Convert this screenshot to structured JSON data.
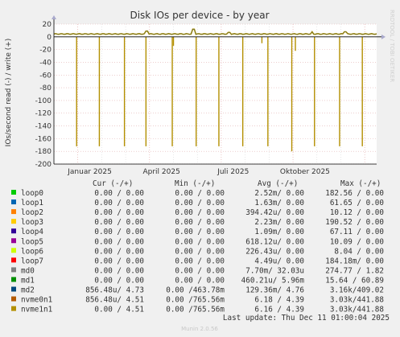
{
  "chart_data": {
    "type": "line",
    "title": "Disk IOs per device - by year",
    "ylabel": "IOs/second read (-) / write (+)",
    "side_label": "RRDTOOL / TOBI OETIKER",
    "ylim": [
      -200,
      20
    ],
    "yticks": [
      20,
      0,
      -20,
      -40,
      -60,
      -80,
      -100,
      -120,
      -140,
      -160,
      -180,
      -200
    ],
    "x_range_months": [
      0,
      13.5
    ],
    "x_month_labels": [
      {
        "label": "Januar 2025",
        "month": 1.5
      },
      {
        "label": "April 2025",
        "month": 4.5
      },
      {
        "label": "Juli 2025",
        "month": 7.5
      },
      {
        "label": "Oktober 2025",
        "month": 10.5
      }
    ],
    "x_minor_months": [
      1,
      2,
      3,
      4,
      5,
      6,
      7,
      8,
      9,
      10,
      11,
      12,
      13
    ],
    "x_major_months": [
      1,
      4,
      7,
      10,
      13
    ],
    "baseline_write": 4.5,
    "read_spikes": [
      {
        "t": 0.95,
        "v": -172
      },
      {
        "t": 1.9,
        "v": -172
      },
      {
        "t": 2.95,
        "v": -172
      },
      {
        "t": 3.85,
        "v": -172
      },
      {
        "t": 4.95,
        "v": -172
      },
      {
        "t": 5.95,
        "v": -172
      },
      {
        "t": 6.9,
        "v": -172
      },
      {
        "t": 7.9,
        "v": -172
      },
      {
        "t": 8.95,
        "v": -172
      },
      {
        "t": 9.95,
        "v": -180
      },
      {
        "t": 10.1,
        "v": -22
      },
      {
        "t": 10.9,
        "v": -172
      },
      {
        "t": 11.95,
        "v": -172
      },
      {
        "t": 12.9,
        "v": -172
      },
      {
        "t": 5.0,
        "v": -14
      },
      {
        "t": 8.7,
        "v": -10
      }
    ],
    "write_bumps": [
      {
        "t": 5.85,
        "v": 12
      },
      {
        "t": 12.2,
        "v": 8
      },
      {
        "t": 10.8,
        "v": 8
      },
      {
        "t": 3.9,
        "v": 9
      },
      {
        "t": 7.3,
        "v": 7
      }
    ],
    "legend_headers": {
      "cur": "Cur (-/+)",
      "min": "Min (-/+)",
      "avg": "Avg (-/+)",
      "max": "Max (-/+)"
    },
    "series": [
      {
        "name": "loop0",
        "color": "#00cc00",
        "cur": "0.00 /  0.00",
        "min": "0.00 /  0.00",
        "avg": "2.52m/  0.00",
        "max": "182.56 /  0.00"
      },
      {
        "name": "loop1",
        "color": "#0066b3",
        "cur": "0.00 /  0.00",
        "min": "0.00 /  0.00",
        "avg": "1.63m/  0.00",
        "max": "61.65 /  0.00"
      },
      {
        "name": "loop2",
        "color": "#ff8000",
        "cur": "0.00 /  0.00",
        "min": "0.00 /  0.00",
        "avg": "394.42u/  0.00",
        "max": "10.12 /  0.00"
      },
      {
        "name": "loop3",
        "color": "#ffcc00",
        "cur": "0.00 /  0.00",
        "min": "0.00 /  0.00",
        "avg": "2.23m/  0.00",
        "max": "190.52 /  0.00"
      },
      {
        "name": "loop4",
        "color": "#330099",
        "cur": "0.00 /  0.00",
        "min": "0.00 /  0.00",
        "avg": "1.09m/  0.00",
        "max": "67.11 /  0.00"
      },
      {
        "name": "loop5",
        "color": "#990099",
        "cur": "0.00 /  0.00",
        "min": "0.00 /  0.00",
        "avg": "618.12u/  0.00",
        "max": "10.09 /  0.00"
      },
      {
        "name": "loop6",
        "color": "#ccff00",
        "cur": "0.00 /  0.00",
        "min": "0.00 /  0.00",
        "avg": "226.43u/  0.00",
        "max": "8.04 /  0.00"
      },
      {
        "name": "loop7",
        "color": "#ff0000",
        "cur": "0.00 /  0.00",
        "min": "0.00 /  0.00",
        "avg": "4.49u/  0.00",
        "max": "184.18m/  0.00"
      },
      {
        "name": "md0",
        "color": "#808080",
        "cur": "0.00 /  0.00",
        "min": "0.00 /  0.00",
        "avg": "7.70m/ 32.03u",
        "max": "274.77 /  1.82"
      },
      {
        "name": "md1",
        "color": "#008f00",
        "cur": "0.00 /  0.00",
        "min": "0.00 /  0.00",
        "avg": "460.21u/  5.96m",
        "max": "15.64 / 60.89"
      },
      {
        "name": "md2",
        "color": "#00487d",
        "cur": "856.48u/  4.73",
        "min": "0.00 /463.78m",
        "avg": "129.36m/  4.76",
        "max": "3.16k/409.02"
      },
      {
        "name": "nvme0n1",
        "color": "#b35a00",
        "cur": "856.48u/  4.51",
        "min": "0.00 /765.56m",
        "avg": "6.18 /  4.39",
        "max": "3.03k/441.88"
      },
      {
        "name": "nvme1n1",
        "color": "#b38f00",
        "cur": "0.00 /  4.51",
        "min": "0.00 /765.56m",
        "avg": "6.16 /  4.39",
        "max": "3.03k/441.88"
      }
    ],
    "last_update": "Last update: Thu Dec 11 01:00:04 2025",
    "footer": "Munin 2.0.56"
  }
}
